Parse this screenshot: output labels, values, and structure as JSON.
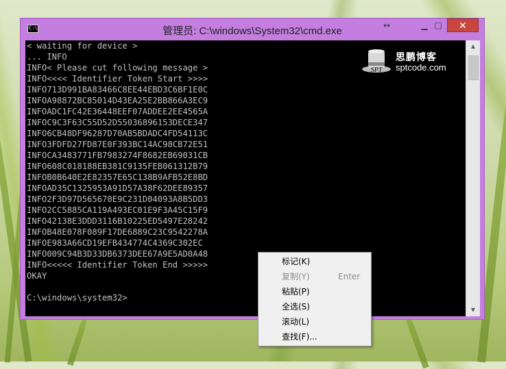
{
  "window": {
    "title": "管理员: C:\\windows\\System32\\cmd.exe",
    "icon_text": "C:\\"
  },
  "controls": {
    "resize": "↔",
    "minimize": "▁",
    "maximize": "□",
    "close": "✕"
  },
  "console": {
    "lines": [
      "< waiting for device >",
      "... INFO",
      "INFO< Please cut following message >",
      "INFO<<<< Identifier Token Start >>>>",
      "INFO713D991BA83466C8EE44EBD3C6BF1E0C",
      "INFOA98872BC85014D43EA25E2BB866A3EC9",
      "INFOADC1FC42E36448EEF07ADDEE2EE4565A",
      "INFOC9C3F63C55D52D55036896153DECE347",
      "INFO6CB48DF96287D70AB5BDADC4FD54113C",
      "INFO3FDFD27FD87E0F393BC14AC98CB72E51",
      "INFOCA3483771FB7983274F8682EB69031CB",
      "INFO608C018188EB381C9135FEB061312B79",
      "INFOB0B640E2E82357E65C138B9AFB52E8BD",
      "INFOAD35C1325953A91D57A38F62DEE89357",
      "INFO2F3D97D565670E9C231D04093A8B5DD3",
      "INFO2CC5885CA119A493EC01E9F3A45C15F9",
      "INFO42138E3DDD3116B10225ED5497E28242",
      "INFOB48E078F089F17DE6889C23C9542278A",
      "INFOE983A66CD19EFB434774C4369C302EC",
      "INFO009C94B3D33DB6373DEE67A9E5AD0A48",
      "INFO<<<<< Identifier Token End >>>>>",
      "OKAY",
      "",
      "C:\\windows\\system32>"
    ]
  },
  "watermark": {
    "title": "思鹏博客",
    "hat_text": "SPT",
    "url": "sptcode.com"
  },
  "context_menu": {
    "items": [
      {
        "label": "标记(K)",
        "shortcut": "",
        "enabled": true
      },
      {
        "label": "复制(Y)",
        "shortcut": "Enter",
        "enabled": false
      },
      {
        "label": "粘贴(P)",
        "shortcut": "",
        "enabled": true
      },
      {
        "label": "全选(S)",
        "shortcut": "",
        "enabled": true
      },
      {
        "label": "滚动(L)",
        "shortcut": "",
        "enabled": true
      },
      {
        "label": "查找(F)...",
        "shortcut": "",
        "enabled": true
      }
    ]
  },
  "colors": {
    "window_frame": "#c37ee0",
    "close_button": "#c7463d",
    "console_bg": "#000000",
    "console_text": "#c0c0c0"
  }
}
